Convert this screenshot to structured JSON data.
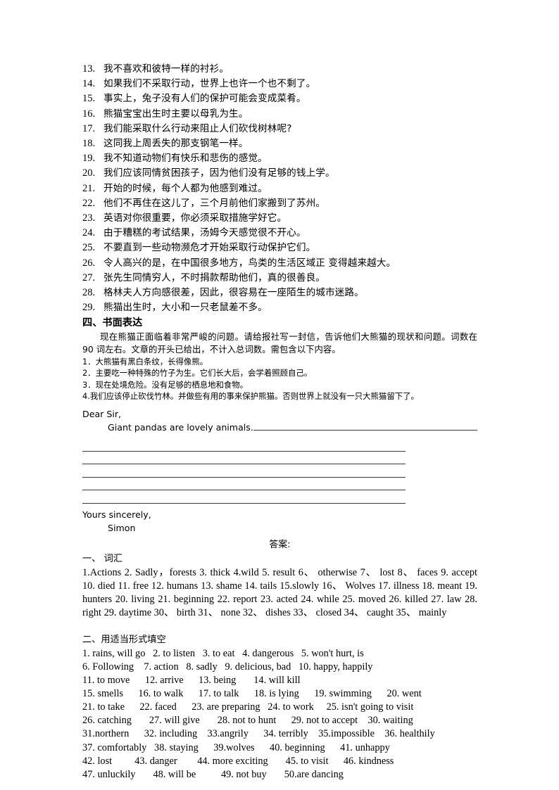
{
  "document": {
    "translation_sentences": [
      {
        "num": "13.",
        "text": "我不喜欢和彼特一样的衬衫。"
      },
      {
        "num": "14.",
        "text": "如果我们不采取行动，世界上也许一个也不剩了。"
      },
      {
        "num": "15.",
        "text": "事实上，兔子没有人们的保护可能会变成菜肴。"
      },
      {
        "num": "16.",
        "text": "熊猫宝宝出生时主要以母乳为生。"
      },
      {
        "num": "17.",
        "text": "我们能采取什么行动来阻止人们砍伐树林呢?"
      },
      {
        "num": "18.",
        "text": "这同我上周丢失的那支钢笔一样。"
      },
      {
        "num": "19.",
        "text": "我不知道动物们有快乐和悲伤的感觉。"
      },
      {
        "num": "20.",
        "text": "我们应该同情贫困孩子，因为他们没有足够的钱上学。"
      },
      {
        "num": "21.",
        "text": "开始的时候，每个人都为他感到难过。"
      },
      {
        "num": "22.",
        "text": "他们不再住在这儿了，三个月前他们家搬到了苏州。"
      },
      {
        "num": "23.",
        "text": "英语对你很重要，你必须采取措施学好它。"
      },
      {
        "num": "24.",
        "text": "由于糟糕的考试结果，汤姆今天感觉很不开心。"
      },
      {
        "num": "25.",
        "text": "不要直到一些动物濒危才开始采取行动保护它们。"
      },
      {
        "num": "26.",
        "text": "令人高兴的是，在中国很多地方，鸟类的生活区域正  变得越来越大。"
      },
      {
        "num": "27.",
        "text": "张先生同情穷人，不时捐款帮助他们，真的很善良。"
      },
      {
        "num": "28.",
        "text": "格林夫人方向感很差，因此，很容易在一座陌生的城市迷路。"
      },
      {
        "num": "29.",
        "text": "熊猫出生时，大小和一只老鼠差不多。"
      }
    ],
    "writing_section": {
      "heading": "四、书面表达",
      "intro": "现在熊猫正面临着非常严峻的问题。请给报社写一封信，告诉他们大熊猫的现状和问题。词数在 90 词左右。文章的开头已给出，不计入总词数。需包含以下内容。",
      "requirements": [
        "1．大熊猫有黑白条纹，长得像熊。",
        "2．主要吃一种特殊的竹子为生。它们长大后，会学着照顾自己。",
        "3．现在处境危险。没有足够的栖息地和食物。",
        "4.我们应该停止砍伐竹林。并做些有用的事来保护熊猫。否则世界上就没有一只大熊猫留下了。"
      ],
      "letter": {
        "salutation": "Dear Sir,",
        "opening": "Giant pandas are lovely animals.",
        "blank_line_count": 5,
        "closing": "Yours sincerely,",
        "signature": "Simon"
      }
    },
    "answer_key": {
      "title": "答案:",
      "sections": [
        {
          "heading": "一、  词汇",
          "justified": true,
          "lines": [
            "1.Actions 2. Sadly，forests 3. thick 4.wild 5. result    6、 otherwise 7、   lost   8、  faces   9. accept",
            "10. died 11. free 12. humans 13. shame 14. tails 15.slowly 16、 Wolves 17. illness 18. meant 19.",
            "hunters 20. living 21. beginning 22. report 23. acted 24. while 25. moved 26. killed 27. law      28.",
            "right 29. daytime 30、 birth 31、 none 32、 dishes 33、 closed 34、 caught 35、 mainly"
          ]
        },
        {
          "heading": "二、用适当形式填空",
          "justified": false,
          "lines": [
            "1. rains, will go   2. to listen   3. to eat   4. dangerous   5. won't hurt, is",
            "6. Following    7. action   8. sadly   9. delicious, bad   10. happy, happily",
            "11. to move      12. arrive      13. being       14. will kill",
            "15. smells      16. to walk      17. to talk      18. is lying      19. swimming      20. went",
            "21. to take      22. faced      23. are preparing   24. to work     25. isn't going to visit",
            "26. catching       27. will give       28. not to hunt      29. not to accept    30. waiting",
            "31.northern      32. including    33.angrily      34. terribly    35.impossible    36. healthily",
            "37. comfortably   38. staying      39.wolves      40. beginning      41. unhappy",
            "42. lost         43. danger        44. more exciting       45. to visit      46. kindness",
            "47. unluckily       48. will be          49. not buy       50.are dancing"
          ]
        }
      ]
    }
  }
}
